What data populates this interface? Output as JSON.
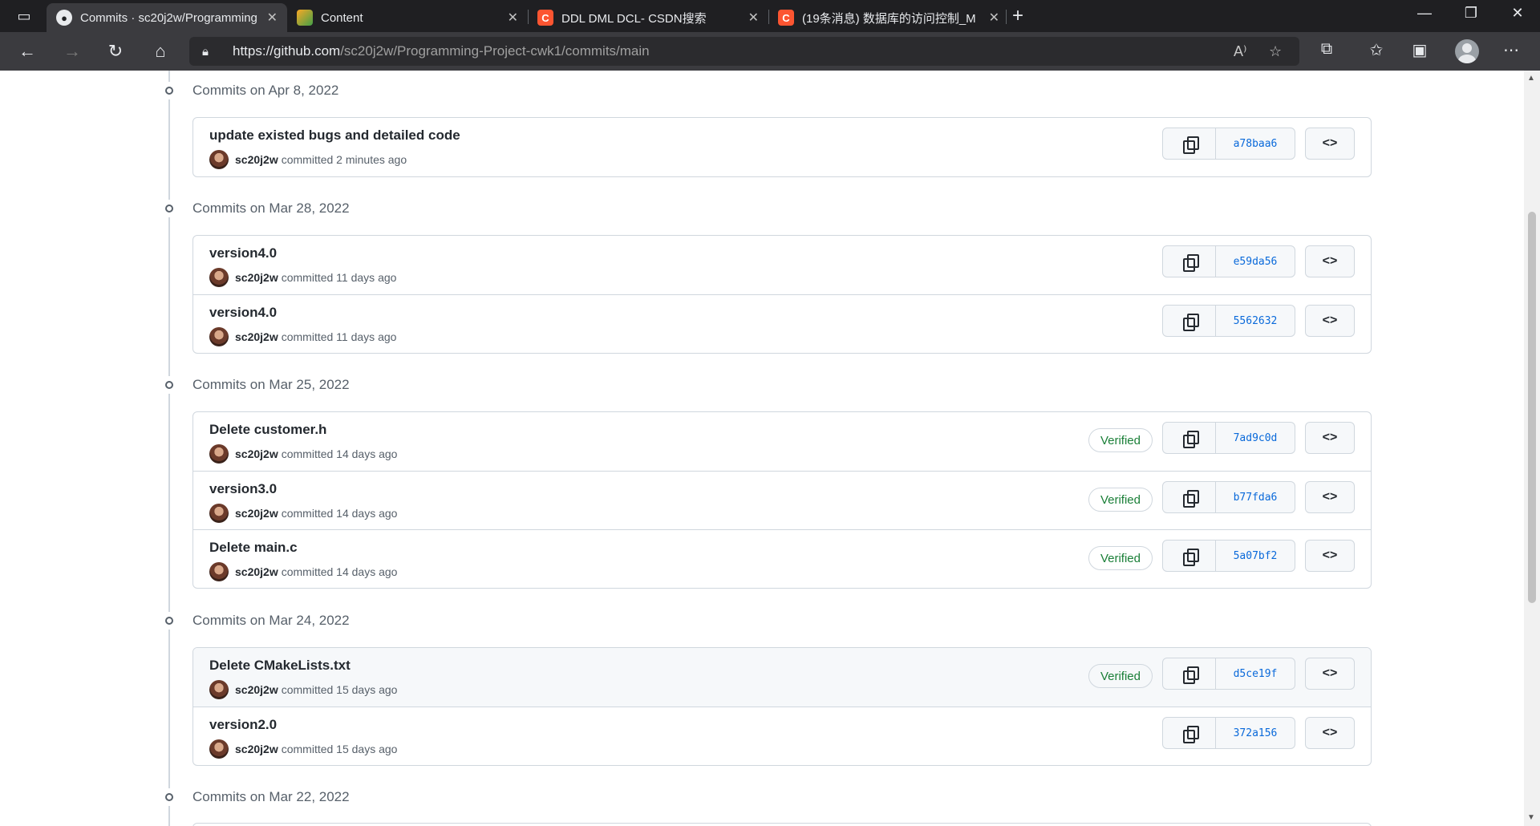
{
  "browser": {
    "tabs": [
      {
        "title": "Commits · sc20j2w/Programming",
        "close": "✕"
      },
      {
        "title": "Content",
        "close": "✕"
      },
      {
        "title": "DDL DML DCL- CSDN搜索",
        "close": "✕"
      },
      {
        "title": "(19条消息) 数据库的访问控制_M",
        "close": "✕"
      }
    ],
    "url_host": "https://github.com",
    "url_path": "/sc20j2w/Programming-Project-cwk1/commits/main"
  },
  "groups": [
    {
      "label": "Commits on Apr 8, 2022",
      "commits": [
        {
          "message": "update existed bugs and detailed code",
          "author": "sc20j2w",
          "time": "committed 2 minutes ago",
          "verified": "",
          "sha": "a78baa6"
        }
      ]
    },
    {
      "label": "Commits on Mar 28, 2022",
      "commits": [
        {
          "message": "version4.0",
          "author": "sc20j2w",
          "time": "committed 11 days ago",
          "verified": "",
          "sha": "e59da56"
        },
        {
          "message": "version4.0",
          "author": "sc20j2w",
          "time": "committed 11 days ago",
          "verified": "",
          "sha": "5562632"
        }
      ]
    },
    {
      "label": "Commits on Mar 25, 2022",
      "commits": [
        {
          "message": "Delete customer.h",
          "author": "sc20j2w",
          "time": "committed 14 days ago",
          "verified": "Verified",
          "sha": "7ad9c0d"
        },
        {
          "message": "version3.0",
          "author": "sc20j2w",
          "time": "committed 14 days ago",
          "verified": "Verified",
          "sha": "b77fda6"
        },
        {
          "message": "Delete main.c",
          "author": "sc20j2w",
          "time": "committed 14 days ago",
          "verified": "Verified",
          "sha": "5a07bf2"
        }
      ]
    },
    {
      "label": "Commits on Mar 24, 2022",
      "commits": [
        {
          "message": "Delete CMakeLists.txt",
          "author": "sc20j2w",
          "time": "committed 15 days ago",
          "verified": "Verified",
          "sha": "d5ce19f"
        },
        {
          "message": "version2.0",
          "author": "sc20j2w",
          "time": "committed 15 days ago",
          "verified": "",
          "sha": "372a156"
        }
      ]
    },
    {
      "label": "Commits on Mar 22, 2022",
      "commits": []
    }
  ],
  "icons": {
    "browse": "<>"
  }
}
